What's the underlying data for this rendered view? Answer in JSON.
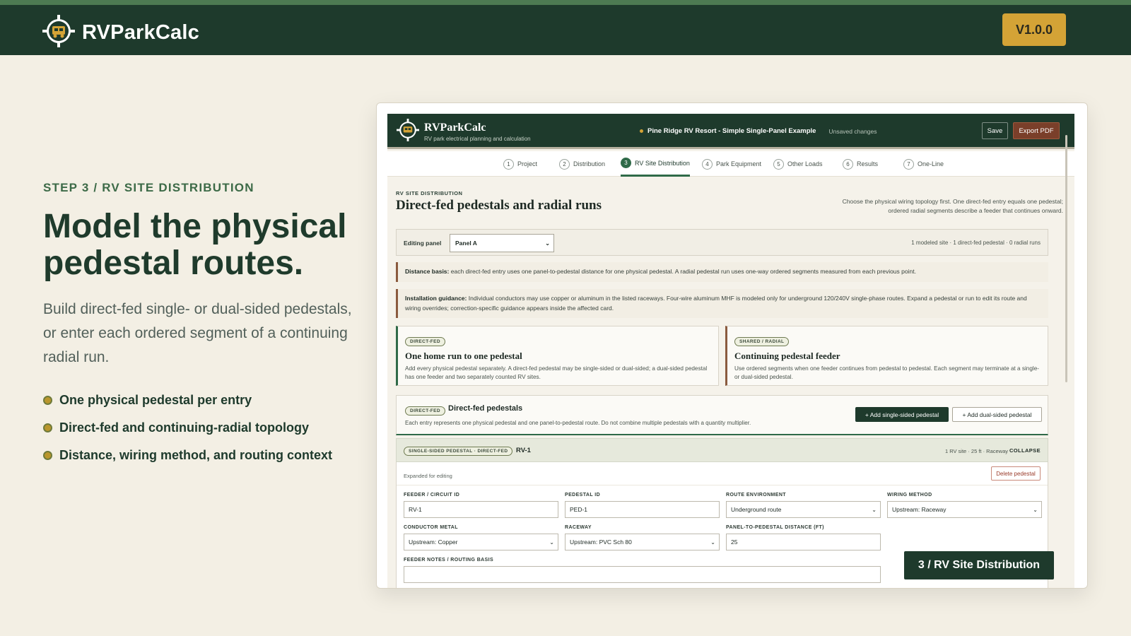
{
  "header": {
    "brand": "RVParkCalc",
    "version": "V1.0.0"
  },
  "hero": {
    "kicker": "STEP 3 / RV SITE DISTRIBUTION",
    "headline": "Model the physical pedestal routes.",
    "lede": "Build direct-fed single- or dual-sided pedestals, or enter each ordered segment of a continuing radial run.",
    "bullets": [
      "One physical pedestal per entry",
      "Direct-fed and continuing-radial topology",
      "Distance, wiring method, and routing context"
    ]
  },
  "app": {
    "title": "RVParkCalc",
    "subtitle": "RV park electrical planning and calculation",
    "project": "Pine Ridge RV Resort - Simple Single-Panel Example",
    "unsaved": "Unsaved changes",
    "save": "Save",
    "export": "Export PDF",
    "tabs": [
      {
        "num": "1",
        "label": "Project"
      },
      {
        "num": "2",
        "label": "Distribution"
      },
      {
        "num": "3",
        "label": "RV Site Distribution"
      },
      {
        "num": "4",
        "label": "Park Equipment"
      },
      {
        "num": "5",
        "label": "Other Loads"
      },
      {
        "num": "6",
        "label": "Results"
      },
      {
        "num": "7",
        "label": "One-Line"
      }
    ],
    "section_kicker": "RV SITE DISTRIBUTION",
    "section_title": "Direct-fed pedestals and radial runs",
    "section_intro": "Choose the physical wiring topology first. One direct-fed entry equals one pedestal; ordered radial segments describe a feeder that continues onward.",
    "panel_label": "Editing panel",
    "panel_value": "Panel A",
    "panel_meta": "1 modeled site · 1 direct-fed pedestal · 0 radial runs",
    "distance_label": "Distance basis:",
    "distance_text": "each direct-fed entry uses one panel-to-pedestal distance for one physical pedestal. A radial pedestal run uses one-way ordered segments measured from each previous point.",
    "install_label": "Installation guidance:",
    "install_text": "Individual conductors may use copper or aluminum in the listed raceways. Four-wire aluminum MHF is modeled only for underground 120/240V single-phase routes. Expand a pedestal or run to edit its route and wiring overrides; correction-specific guidance appears inside the affected card.",
    "card_direct": {
      "pill": "DIRECT-FED",
      "title": "One home run to one pedestal",
      "text": "Add every physical pedestal separately. A direct-fed pedestal may be single-sided or dual-sided; a dual-sided pedestal has one feeder and two separately counted RV sites."
    },
    "card_radial": {
      "pill": "SHARED / RADIAL",
      "title": "Continuing pedestal feeder",
      "text": "Use ordered segments when one feeder continues from pedestal to pedestal. Each segment may terminate at a single- or dual-sided pedestal."
    },
    "df_section": {
      "pill": "DIRECT-FED",
      "title": "Direct-fed pedestals",
      "desc": "Each entry represents one physical pedestal and one panel-to-pedestal route. Do not combine multiple pedestals with a quantity multiplier.",
      "add_single": "+ Add single-sided pedestal",
      "add_dual": "+ Add dual-sided pedestal"
    },
    "pedestal": {
      "pill": "SINGLE-SIDED PEDESTAL · DIRECT-FED",
      "id": "RV-1",
      "meta": "1 RV site · 25 ft · Raceway",
      "collapse": "COLLAPSE",
      "expanded": "Expanded for editing",
      "delete": "Delete pedestal",
      "fields": {
        "feeder_label": "FEEDER / CIRCUIT ID",
        "feeder_value": "RV-1",
        "pedestal_label": "PEDESTAL ID",
        "pedestal_value": "PED-1",
        "route_label": "ROUTE ENVIRONMENT",
        "route_value": "Underground route",
        "wiring_label": "WIRING METHOD",
        "wiring_value": "Upstream: Raceway",
        "metal_label": "CONDUCTOR METAL",
        "metal_value": "Upstream: Copper",
        "raceway_label": "RACEWAY",
        "raceway_value": "Upstream: PVC Sch 80",
        "distance_label": "PANEL-TO-PEDESTAL DISTANCE (FT)",
        "distance_value": "25",
        "notes_label": "FEEDER NOTES / ROUTING BASIS"
      }
    }
  },
  "step_badge": "3 / RV Site Distribution",
  "colors": {
    "brand_dark": "#1e3a2c",
    "accent_gold": "#d4a336",
    "page_bg": "#f3efe4",
    "export_btn": "#7a3f2a"
  },
  "icons": {
    "logo": "rv-crosshair-logo-icon"
  }
}
